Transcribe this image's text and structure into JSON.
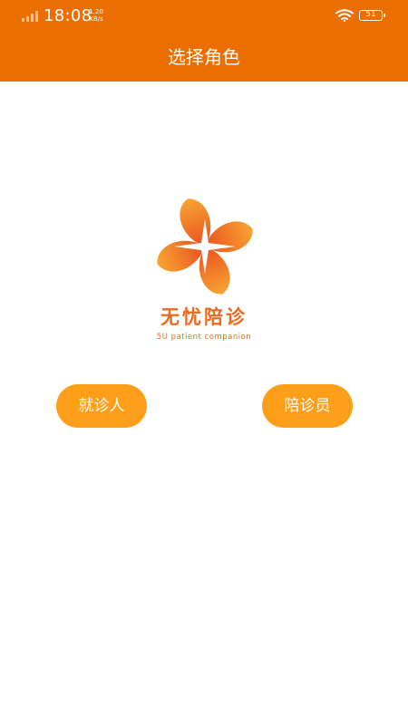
{
  "status_bar": {
    "time": "18:08",
    "network_speed_value": "1.20",
    "network_speed_unit": "KB/s",
    "battery_level": "51",
    "icons": [
      "signal-icon",
      "wifi-icon",
      "battery-icon"
    ]
  },
  "header": {
    "title": "选择角色"
  },
  "logo": {
    "name": "无忧陪诊",
    "subtitle": "5U patient companion",
    "icon": "four-petal-logo-icon",
    "colors": {
      "primary": "#EB6A1E",
      "light": "#F8A533"
    }
  },
  "roles": {
    "patient_label": "就诊人",
    "companion_label": "陪诊员"
  },
  "colors": {
    "header_bg": "#ED6E00",
    "button_bg": "#FF9F19",
    "page_bg": "#FFFFFF"
  }
}
